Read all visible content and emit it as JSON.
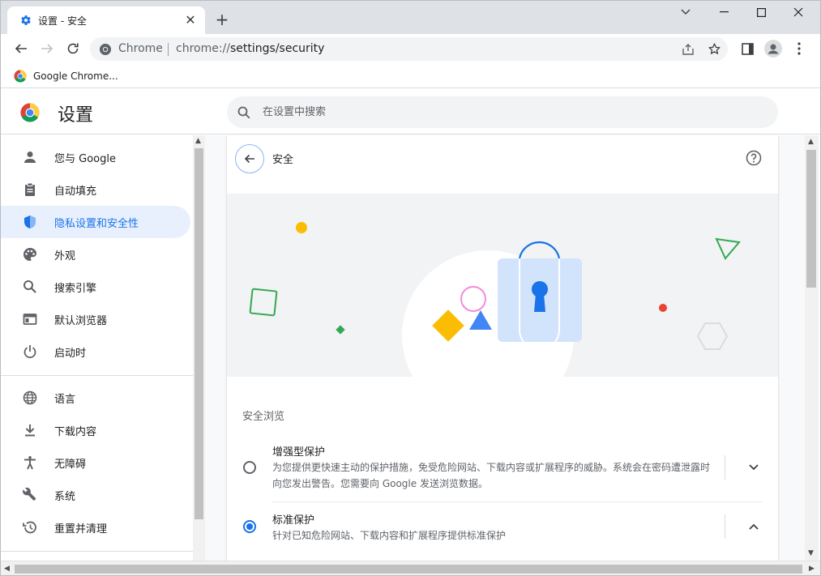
{
  "window": {
    "tab_title": "设置 - 安全",
    "minimize_glyph": "—",
    "maximize_glyph": "☐",
    "close_glyph": "✕",
    "collapse_glyph": "⌄"
  },
  "toolbar": {
    "site_label": "Chrome",
    "url_scheme": "chrome://",
    "url_path": "settings/security"
  },
  "bookmarks": [
    {
      "label": "Google Chrome..."
    }
  ],
  "header": {
    "title": "设置",
    "search_placeholder": "在设置中搜索"
  },
  "sidebar": {
    "items": [
      {
        "label": "您与 Google",
        "icon": "person-icon",
        "active": false
      },
      {
        "label": "自动填充",
        "icon": "clipboard-icon",
        "active": false
      },
      {
        "label": "隐私设置和安全性",
        "icon": "shield-icon",
        "active": true
      },
      {
        "label": "外观",
        "icon": "palette-icon",
        "active": false
      },
      {
        "label": "搜索引擎",
        "icon": "search-icon",
        "active": false
      },
      {
        "label": "默认浏览器",
        "icon": "browser-icon",
        "active": false
      },
      {
        "label": "启动时",
        "icon": "power-icon",
        "active": false
      },
      {
        "label": "语言",
        "icon": "globe-icon",
        "active": false
      },
      {
        "label": "下载内容",
        "icon": "download-icon",
        "active": false
      },
      {
        "label": "无障碍",
        "icon": "accessibility-icon",
        "active": false
      },
      {
        "label": "系统",
        "icon": "wrench-icon",
        "active": false
      },
      {
        "label": "重置并清理",
        "icon": "history-icon",
        "active": false
      }
    ]
  },
  "page": {
    "title": "安全",
    "section_title": "安全浏览",
    "options": [
      {
        "title": "增强型保护",
        "description": "为您提供更快速主动的保护措施，免受危险网站、下载内容或扩展程序的威胁。系统会在密码遭泄露时向您发出警告。您需要向 Google 发送浏览数据。",
        "selected": false,
        "expanded": false
      },
      {
        "title": "标准保护",
        "description": "针对已知危险网站、下载内容和扩展程序提供标准保护",
        "selected": true,
        "expanded": true
      }
    ]
  },
  "colors": {
    "accent": "#1a73e8",
    "active_bg": "#e8f0fe",
    "lock_body": "#d2e3fc",
    "yellow": "#fbbc04",
    "green": "#34a853",
    "red": "#ea4335",
    "pink": "#f28bd9"
  }
}
